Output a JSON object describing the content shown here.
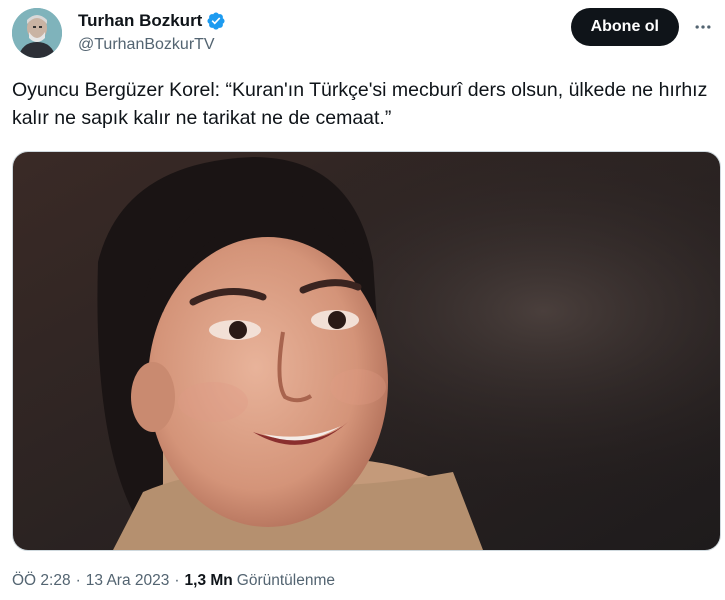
{
  "author": {
    "display_name": "Turhan Bozkurt",
    "handle": "@TurhanBozkurTV",
    "verified": true,
    "avatar_icon": "profile-photo"
  },
  "actions": {
    "subscribe_label": "Abone ol",
    "more_icon": "ellipsis-icon"
  },
  "tweet": {
    "text": "Oyuncu Bergüzer Korel: “Kuran'ın Türkçe'si mecburî ders olsun, ülkede ne hırhız kalır ne sapık kalır ne tarikat ne de cemaat.”",
    "media": {
      "type": "photo",
      "description_icon": "portrait-photo"
    }
  },
  "meta": {
    "time": "ÖÖ 2:28",
    "separator": "·",
    "date": "13 Ara 2023",
    "views_count": "1,3 Mn",
    "views_label": "Görüntülenme"
  },
  "colors": {
    "text_primary": "#0f1419",
    "text_secondary": "#536471",
    "verified_blue": "#1d9bf0",
    "button_bg": "#0f1419",
    "button_text": "#ffffff"
  }
}
